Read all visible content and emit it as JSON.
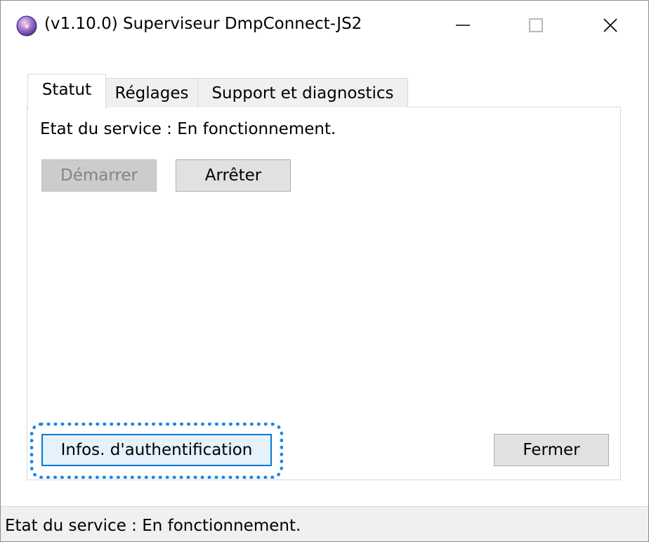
{
  "window": {
    "title": "(v1.10.0) Superviseur DmpConnect-JS2",
    "icon": "app-disc-icon"
  },
  "tabs": [
    {
      "label": "Statut",
      "active": true
    },
    {
      "label": "Réglages",
      "active": false
    },
    {
      "label": "Support et diagnostics",
      "active": false
    }
  ],
  "statut": {
    "service_state": "Etat du service : En fonctionnement.",
    "start_label": "Démarrer",
    "stop_label": "Arrêter",
    "auth_info_label": "Infos. d'authentification",
    "close_label": "Fermer"
  },
  "statusbar": {
    "text": "Etat du service : En fonctionnement."
  },
  "colors": {
    "accent": "#0078d7",
    "focus_ring": "#1a86e8",
    "disabled_text": "#838383"
  }
}
